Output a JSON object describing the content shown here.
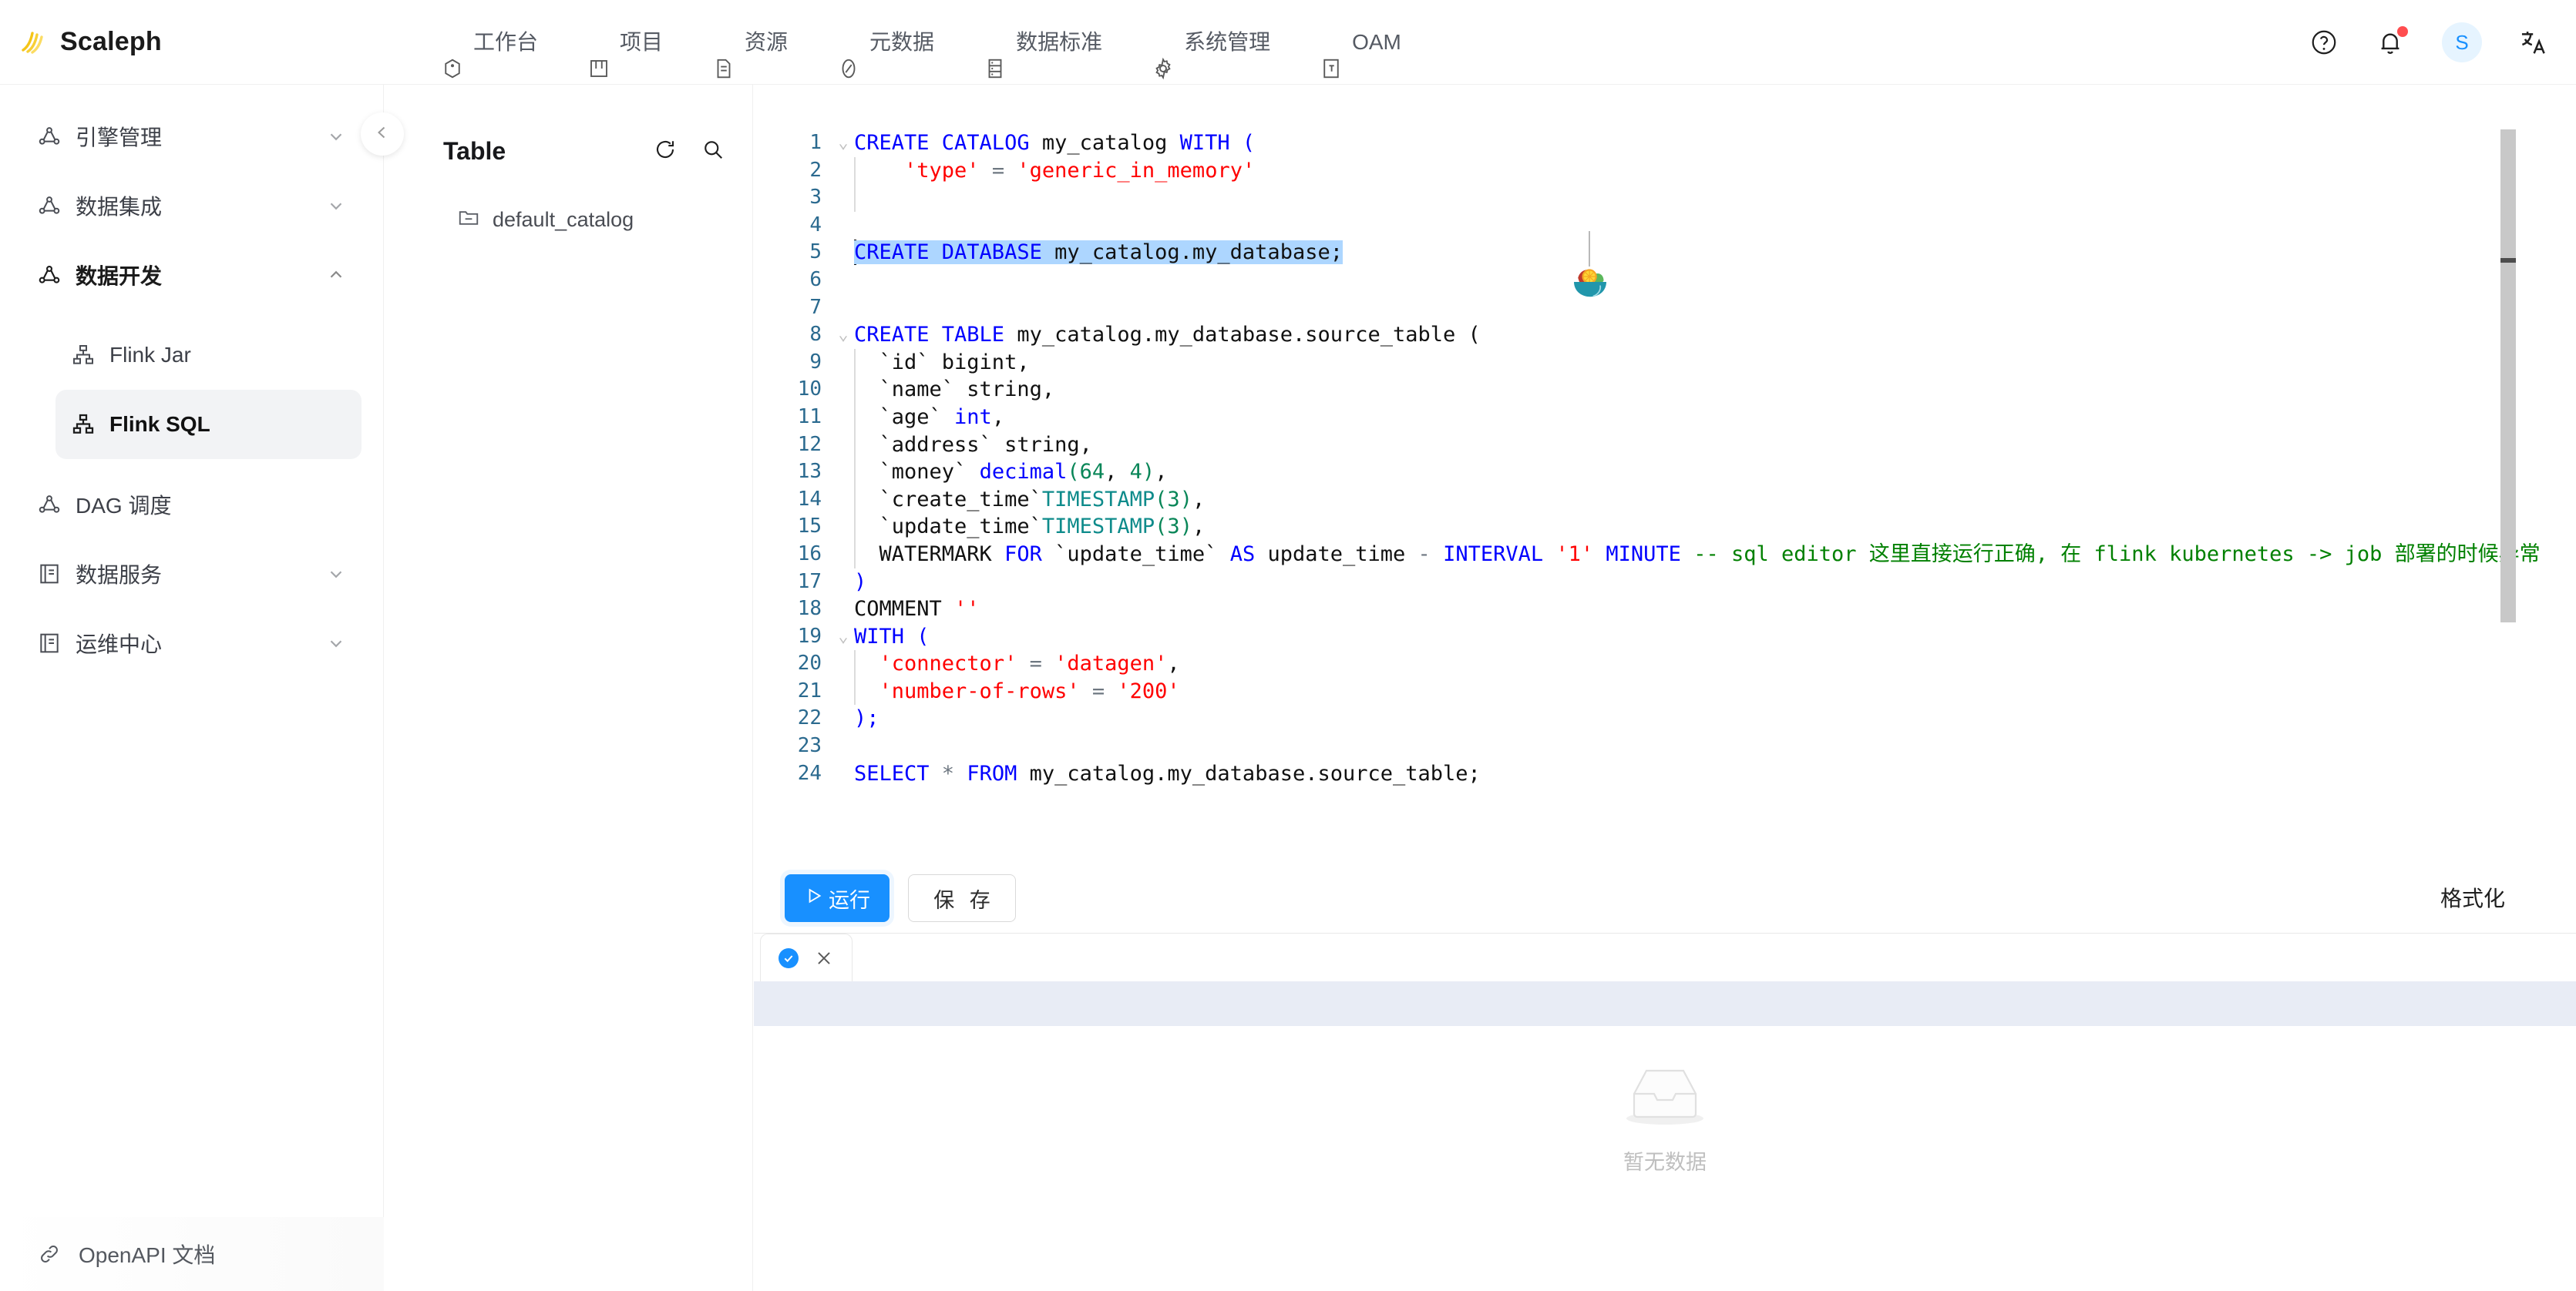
{
  "app": {
    "brand": "Scaleph",
    "logo_icon": "scaleph-logo-icon"
  },
  "header": {
    "nav": [
      {
        "label": "工作台",
        "icon": "workbench-icon"
      },
      {
        "label": "项目",
        "icon": "project-icon"
      },
      {
        "label": "资源",
        "icon": "resource-icon"
      },
      {
        "label": "元数据",
        "icon": "metadata-icon"
      },
      {
        "label": "数据标准",
        "icon": "data-standard-icon"
      },
      {
        "label": "系统管理",
        "icon": "gear-icon"
      },
      {
        "label": "OAM",
        "icon": "oam-icon"
      }
    ],
    "help_icon": "help-circle-icon",
    "notification_icon": "bell-icon",
    "notification_badge": "",
    "avatar_label": "S",
    "language_icon": "translate-icon",
    "accent": "#1890ff",
    "badge_color": "#ff4d4f"
  },
  "sidebar": {
    "items": [
      {
        "label": "引擎管理",
        "icon": "engine-icon",
        "expandable": true,
        "expanded": false,
        "level": 0
      },
      {
        "label": "数据集成",
        "icon": "integration-icon",
        "expandable": true,
        "expanded": false,
        "level": 0
      },
      {
        "label": "数据开发",
        "icon": "dev-icon",
        "expandable": true,
        "expanded": true,
        "level": 0
      },
      {
        "label": "Flink Jar",
        "icon": "flink-node-icon",
        "expandable": false,
        "expanded": false,
        "level": 1
      },
      {
        "label": "Flink SQL",
        "icon": "flink-node-icon",
        "expandable": false,
        "expanded": false,
        "level": 1,
        "active": true
      },
      {
        "label": "DAG 调度",
        "icon": "dag-icon",
        "expandable": false,
        "expanded": false,
        "level": 0
      },
      {
        "label": "数据服务",
        "icon": "service-icon",
        "expandable": true,
        "expanded": false,
        "level": 0
      },
      {
        "label": "运维中心",
        "icon": "ops-icon",
        "expandable": true,
        "expanded": false,
        "level": 0
      }
    ],
    "footer": {
      "label": "OpenAPI 文档",
      "icon": "link-icon"
    },
    "collapse_icon": "chevron-left-icon"
  },
  "catalog": {
    "title": "Table",
    "refresh_icon": "refresh-icon",
    "search_icon": "search-icon",
    "tree": [
      {
        "label": "default_catalog",
        "icon": "folder-collapsed-icon"
      }
    ]
  },
  "editor": {
    "overlay_emoji": "salad-bowl-emoji",
    "selection_line": 5,
    "lines": [
      {
        "n": 1,
        "fold": "v",
        "indent": false,
        "tokens": [
          {
            "t": "CREATE CATALOG ",
            "c": "kw"
          },
          {
            "t": "my_catalog ",
            "c": "pl"
          },
          {
            "t": "WITH (",
            "c": "kw"
          }
        ]
      },
      {
        "n": 2,
        "fold": "",
        "indent": true,
        "tokens": [
          {
            "t": "    ",
            "c": "pl"
          },
          {
            "t": "'type'",
            "c": "str"
          },
          {
            "t": " = ",
            "c": "op"
          },
          {
            "t": "'generic_in_memory'",
            "c": "str"
          }
        ]
      },
      {
        "n": 3,
        "fold": "",
        "indent": true,
        "tokens": []
      },
      {
        "n": 4,
        "fold": "",
        "indent": false,
        "tokens": []
      },
      {
        "n": 5,
        "fold": "",
        "indent": false,
        "selected": true,
        "tokens": [
          {
            "t": "CREATE DATABASE ",
            "c": "kw"
          },
          {
            "t": "my_catalog.my_database;",
            "c": "pl"
          }
        ]
      },
      {
        "n": 6,
        "fold": "",
        "indent": false,
        "tokens": []
      },
      {
        "n": 7,
        "fold": "",
        "indent": false,
        "tokens": []
      },
      {
        "n": 8,
        "fold": "v",
        "indent": false,
        "tokens": [
          {
            "t": "CREATE TABLE ",
            "c": "kw"
          },
          {
            "t": "my_catalog.my_database.source_table (",
            "c": "pl"
          }
        ]
      },
      {
        "n": 9,
        "fold": "",
        "indent": true,
        "tokens": [
          {
            "t": "  `id` bigint,",
            "c": "pl"
          }
        ]
      },
      {
        "n": 10,
        "fold": "",
        "indent": true,
        "tokens": [
          {
            "t": "  `name` string,",
            "c": "pl"
          }
        ]
      },
      {
        "n": 11,
        "fold": "",
        "indent": true,
        "tokens": [
          {
            "t": "  `age` ",
            "c": "pl"
          },
          {
            "t": "int",
            "c": "kw"
          },
          {
            "t": ",",
            "c": "pl"
          }
        ]
      },
      {
        "n": 12,
        "fold": "",
        "indent": true,
        "tokens": [
          {
            "t": "  `address` string,",
            "c": "pl"
          }
        ]
      },
      {
        "n": 13,
        "fold": "",
        "indent": true,
        "tokens": [
          {
            "t": "  `money` ",
            "c": "pl"
          },
          {
            "t": "decimal",
            "c": "kw"
          },
          {
            "t": "(",
            "c": "num"
          },
          {
            "t": "64",
            "c": "num"
          },
          {
            "t": ", ",
            "c": "pl"
          },
          {
            "t": "4",
            "c": "num"
          },
          {
            "t": ")",
            "c": "num"
          },
          {
            "t": ",",
            "c": "pl"
          }
        ]
      },
      {
        "n": 14,
        "fold": "",
        "indent": true,
        "tokens": [
          {
            "t": "  `create_time`",
            "c": "pl"
          },
          {
            "t": "TIMESTAMP",
            "c": "fn"
          },
          {
            "t": "(",
            "c": "num"
          },
          {
            "t": "3",
            "c": "num"
          },
          {
            "t": ")",
            "c": "num"
          },
          {
            "t": ",",
            "c": "pl"
          }
        ]
      },
      {
        "n": 15,
        "fold": "",
        "indent": true,
        "tokens": [
          {
            "t": "  `update_time`",
            "c": "pl"
          },
          {
            "t": "TIMESTAMP",
            "c": "fn"
          },
          {
            "t": "(",
            "c": "num"
          },
          {
            "t": "3",
            "c": "num"
          },
          {
            "t": ")",
            "c": "num"
          },
          {
            "t": ",",
            "c": "pl"
          }
        ]
      },
      {
        "n": 16,
        "fold": "",
        "indent": true,
        "tokens": [
          {
            "t": "  WATERMARK ",
            "c": "pl"
          },
          {
            "t": "FOR ",
            "c": "kw"
          },
          {
            "t": "`update_time` ",
            "c": "pl"
          },
          {
            "t": "AS ",
            "c": "kw"
          },
          {
            "t": "update_time ",
            "c": "pl"
          },
          {
            "t": "- ",
            "c": "op"
          },
          {
            "t": "INTERVAL ",
            "c": "kw"
          },
          {
            "t": "'1' ",
            "c": "str"
          },
          {
            "t": "MINUTE ",
            "c": "kw"
          },
          {
            "t": "-- sql editor 这里直接运行正确, 在 flink kubernetes -> job 部署的时候异常",
            "c": "cmt"
          }
        ]
      },
      {
        "n": 17,
        "fold": "",
        "indent": false,
        "tokens": [
          {
            "t": ")",
            "c": "kw"
          }
        ]
      },
      {
        "n": 18,
        "fold": "",
        "indent": false,
        "tokens": [
          {
            "t": "COMMENT ",
            "c": "pl"
          },
          {
            "t": "''",
            "c": "str"
          }
        ]
      },
      {
        "n": 19,
        "fold": "v",
        "indent": false,
        "tokens": [
          {
            "t": "WITH (",
            "c": "kw"
          }
        ]
      },
      {
        "n": 20,
        "fold": "",
        "indent": true,
        "tokens": [
          {
            "t": "  ",
            "c": "pl"
          },
          {
            "t": "'connector'",
            "c": "str"
          },
          {
            "t": " = ",
            "c": "op"
          },
          {
            "t": "'datagen'",
            "c": "str"
          },
          {
            "t": ",",
            "c": "pl"
          }
        ]
      },
      {
        "n": 21,
        "fold": "",
        "indent": true,
        "tokens": [
          {
            "t": "  ",
            "c": "pl"
          },
          {
            "t": "'number-of-rows'",
            "c": "str"
          },
          {
            "t": " = ",
            "c": "op"
          },
          {
            "t": "'200'",
            "c": "str"
          }
        ]
      },
      {
        "n": 22,
        "fold": "",
        "indent": false,
        "tokens": [
          {
            "t": ");",
            "c": "kw"
          }
        ]
      },
      {
        "n": 23,
        "fold": "",
        "indent": false,
        "tokens": []
      },
      {
        "n": 24,
        "fold": "",
        "indent": false,
        "tokens": [
          {
            "t": "SELECT ",
            "c": "kw"
          },
          {
            "t": "* ",
            "c": "op"
          },
          {
            "t": "FROM ",
            "c": "kw"
          },
          {
            "t": "my_catalog.my_database.source_table;",
            "c": "pl"
          }
        ]
      }
    ]
  },
  "toolbar": {
    "run_label": "运行",
    "run_icon": "play-icon",
    "save_label": "保 存",
    "format_label": "格式化"
  },
  "result": {
    "tab": {
      "status_icon": "check-circle-icon",
      "close_icon": "close-icon"
    },
    "empty_icon": "empty-box-icon",
    "empty_text": "暂无数据"
  }
}
